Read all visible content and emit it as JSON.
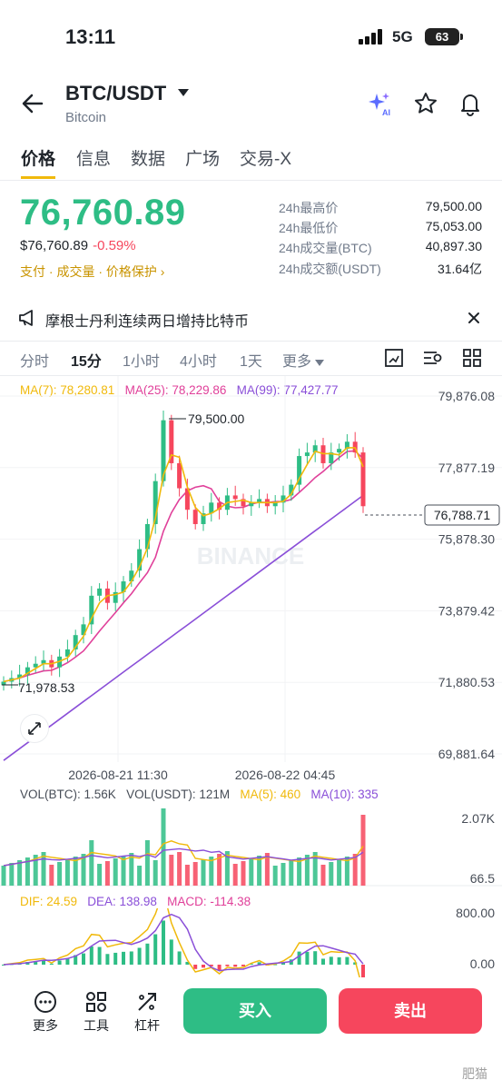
{
  "status": {
    "time": "13:11",
    "network": "5G",
    "battery": "63"
  },
  "header": {
    "pair": "BTC/USDT",
    "name": "Bitcoin"
  },
  "tabs": [
    "价格",
    "信息",
    "数据",
    "广场",
    "交易-X"
  ],
  "price": {
    "last": "76,760.89",
    "usd": "$76,760.89",
    "change_pct": "-0.59%",
    "links": "支付 · 成交量 · 价格保护 ›"
  },
  "stats": [
    {
      "label": "24h最高价",
      "value": "79,500.00"
    },
    {
      "label": "24h最低价",
      "value": "75,053.00"
    },
    {
      "label": "24h成交量(BTC)",
      "value": "40,897.30"
    },
    {
      "label": "24h成交额(USDT)",
      "value": "31.64亿"
    }
  ],
  "notice": {
    "text": "摩根士丹利连续两日增持比特币"
  },
  "intervals": [
    "分时",
    "15分",
    "1小时",
    "4小时",
    "1天",
    "更多"
  ],
  "ma_legend": {
    "ma7": "MA(7): 78,280.81",
    "ma25": "MA(25): 78,229.86",
    "ma99": "MA(99): 77,427.77"
  },
  "colors": {
    "up": "#2ebd85",
    "down": "#f6465d",
    "ma7": "#f0b90b",
    "ma25": "#e0409a",
    "ma99": "#8a4fd8",
    "accent": "#f0b90b"
  },
  "chart_data": [
    {
      "type": "candlestick",
      "price_ticks": [
        "79,876.08",
        "77,877.19",
        "75,878.30",
        "73,879.42",
        "71,880.53",
        "69,881.64"
      ],
      "ylim": [
        69881.64,
        79876.08
      ],
      "x_labels": [
        "2026-08-21 11:30",
        "2026-08-22 04:45"
      ],
      "annotations": {
        "high": "79,500.00",
        "low": "71,978.53",
        "current": "76,788.71"
      },
      "close_approx": [
        71900,
        72000,
        72100,
        72300,
        72400,
        72500,
        72300,
        72600,
        72800,
        73200,
        73500,
        74300,
        74500,
        74100,
        74400,
        74700,
        75000,
        75600,
        76300,
        77500,
        79200,
        78000,
        77300,
        76700,
        76300,
        76600,
        76900,
        76700,
        77100,
        77000,
        76800,
        76900,
        77000,
        76800,
        76900,
        77100,
        77400,
        78200,
        78300,
        78500,
        78000,
        78300,
        78400,
        78600,
        78300,
        76800
      ]
    },
    {
      "type": "bar",
      "legend": {
        "vol_btc": "VOL(BTC): 1.56K",
        "vol_usdt": "VOL(USDT): 121M",
        "ma5": "MA(5): 460",
        "ma10": "MA(10): 335"
      },
      "ticks": [
        "2.07K",
        "66.5"
      ]
    },
    {
      "type": "line",
      "legend": {
        "dif": "DIF: 24.59",
        "dea": "DEA: 138.98",
        "macd": "MACD: -114.38"
      },
      "ticks": [
        "800.00",
        "0.00"
      ]
    }
  ],
  "watermark": "BINANCE",
  "bottom": {
    "tools": [
      "更多",
      "工具",
      "杠杆"
    ],
    "buy": "买入",
    "sell": "卖出",
    "footer_mark": "肥猫"
  }
}
